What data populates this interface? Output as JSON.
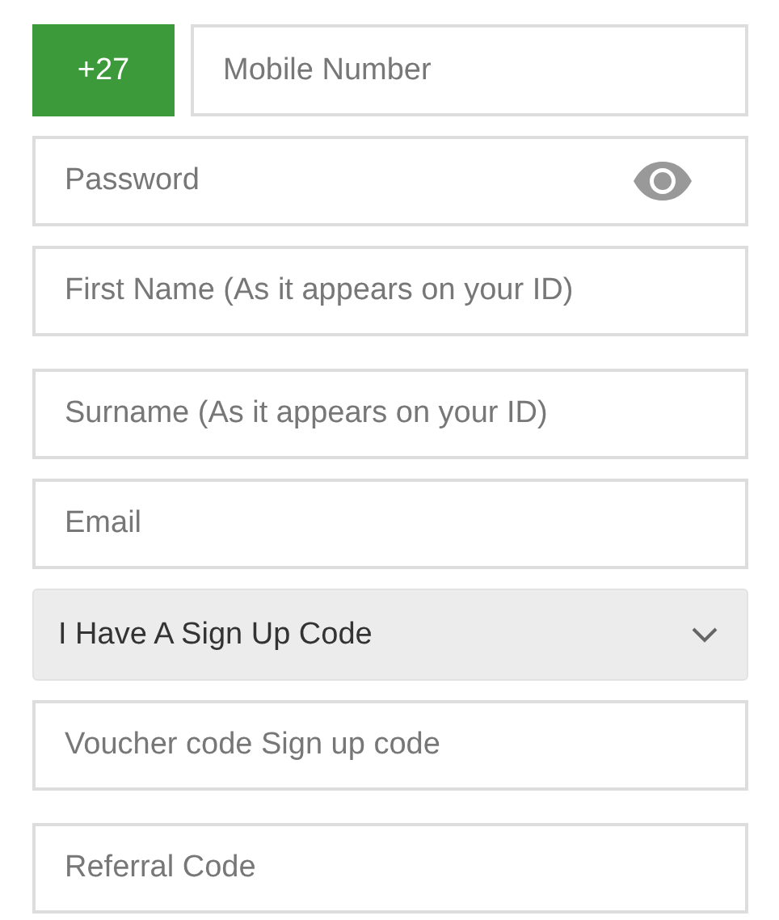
{
  "fields": [
    {
      "kind": "phone",
      "prefix": "+27",
      "placeholder": "Mobile Number"
    },
    {
      "kind": "password",
      "placeholder": "Password"
    },
    {
      "kind": "text",
      "placeholder": "First Name (As it appears on your ID)"
    },
    {
      "kind": "text",
      "placeholder": "Surname (As it appears on your ID)"
    },
    {
      "kind": "text",
      "placeholder": "Email"
    },
    {
      "kind": "select",
      "value": "I Have A Sign Up Code"
    },
    {
      "kind": "text",
      "placeholder": "Voucher code Sign up code"
    },
    {
      "kind": "text",
      "placeholder": "Referral Code"
    }
  ]
}
